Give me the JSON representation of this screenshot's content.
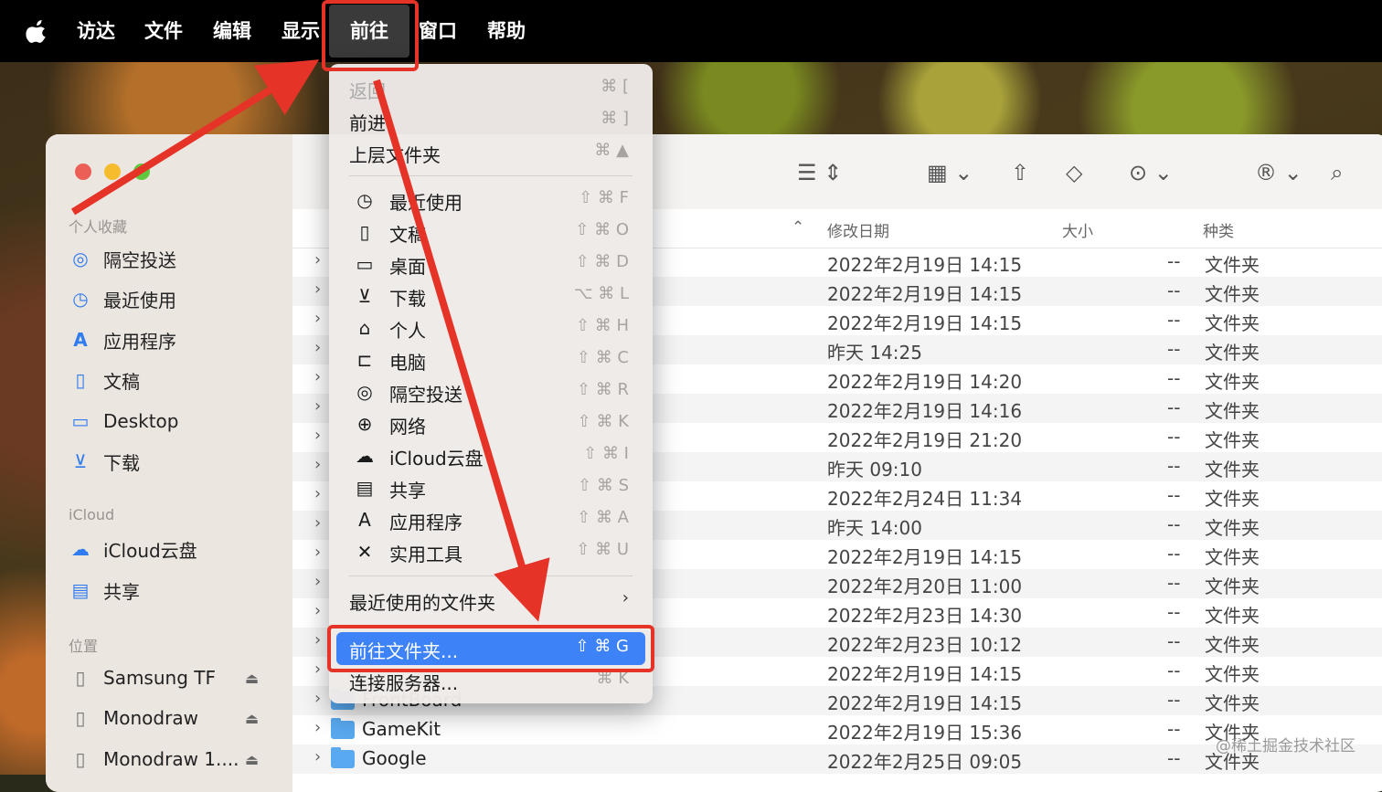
{
  "menubar": {
    "items": [
      "访达",
      "文件",
      "编辑",
      "显示",
      "前往",
      "窗口",
      "帮助"
    ]
  },
  "sidebar": {
    "favorites_title": "个人收藏",
    "favorites": [
      {
        "label": "隔空投送",
        "icon": "airdrop-icon"
      },
      {
        "label": "最近使用",
        "icon": "clock-icon"
      },
      {
        "label": "应用程序",
        "icon": "apps-icon"
      },
      {
        "label": "文稿",
        "icon": "document-icon"
      },
      {
        "label": "Desktop",
        "icon": "desktop-icon"
      },
      {
        "label": "下载",
        "icon": "download-icon"
      }
    ],
    "icloud_title": "iCloud",
    "icloud": [
      {
        "label": "iCloud云盘",
        "icon": "cloud-icon"
      },
      {
        "label": "共享",
        "icon": "shared-folder-icon"
      }
    ],
    "locations_title": "位置",
    "locations": [
      {
        "label": "Samsung TF",
        "icon": "drive-icon"
      },
      {
        "label": "Monodraw",
        "icon": "drive-icon"
      },
      {
        "label": "Monodraw 1....",
        "icon": "drive-icon"
      }
    ]
  },
  "columns": {
    "date": "修改日期",
    "size": "大小",
    "kind": "种类"
  },
  "files": [
    {
      "name": "",
      "date": "2022年2月19日 14:15",
      "size": "--",
      "kind": "文件夹"
    },
    {
      "name": "",
      "date": "2022年2月19日 14:15",
      "size": "--",
      "kind": "文件夹"
    },
    {
      "name": "",
      "date": "2022年2月19日 14:15",
      "size": "--",
      "kind": "文件夹"
    },
    {
      "name": "",
      "date": "昨天 14:25",
      "size": "--",
      "kind": "文件夹"
    },
    {
      "name": "",
      "date": "2022年2月19日 14:20",
      "size": "--",
      "kind": "文件夹"
    },
    {
      "name": "",
      "date": "2022年2月19日 14:16",
      "size": "--",
      "kind": "文件夹"
    },
    {
      "name": "",
      "date": "2022年2月19日 21:20",
      "size": "--",
      "kind": "文件夹"
    },
    {
      "name": "",
      "date": "昨天 09:10",
      "size": "--",
      "kind": "文件夹"
    },
    {
      "name": "",
      "date": "2022年2月24日 11:34",
      "size": "--",
      "kind": "文件夹"
    },
    {
      "name": "",
      "date": "昨天 14:00",
      "size": "--",
      "kind": "文件夹"
    },
    {
      "name": "",
      "date": "2022年2月19日 14:15",
      "size": "--",
      "kind": "文件夹"
    },
    {
      "name": "",
      "date": "2022年2月20日 11:00",
      "size": "--",
      "kind": "文件夹"
    },
    {
      "name": "",
      "date": "2022年2月23日 14:30",
      "size": "--",
      "kind": "文件夹"
    },
    {
      "name": "",
      "date": "2022年2月23日 10:12",
      "size": "--",
      "kind": "文件夹"
    },
    {
      "name": "",
      "date": "2022年2月19日 14:15",
      "size": "--",
      "kind": "文件夹"
    },
    {
      "name": "FrontBoard",
      "date": "2022年2月19日 14:15",
      "size": "--",
      "kind": "文件夹"
    },
    {
      "name": "GameKit",
      "date": "2022年2月19日 15:36",
      "size": "--",
      "kind": "文件夹"
    },
    {
      "name": "Google",
      "date": "2022年2月25日 09:05",
      "size": "--",
      "kind": "文件夹"
    }
  ],
  "go_menu": {
    "top": [
      {
        "label": "返回",
        "shortcut": "⌘ [",
        "disabled": true
      },
      {
        "label": "前进",
        "shortcut": "⌘ ]",
        "disabled": false
      },
      {
        "label": "上层文件夹",
        "shortcut": "⌘ ▲",
        "disabled": false
      }
    ],
    "places": [
      {
        "label": "最近使用",
        "shortcut": "⇧ ⌘ F",
        "icon": "clock-icon",
        "glyph": "◷"
      },
      {
        "label": "文稿",
        "shortcut": "⇧ ⌘ O",
        "icon": "document-icon",
        "glyph": "▯"
      },
      {
        "label": "桌面",
        "shortcut": "⇧ ⌘ D",
        "icon": "desktop-icon",
        "glyph": "▭"
      },
      {
        "label": "下载",
        "shortcut": "⌥ ⌘ L",
        "icon": "download-icon",
        "glyph": "⊻"
      },
      {
        "label": "个人",
        "shortcut": "⇧ ⌘ H",
        "icon": "home-icon",
        "glyph": "⌂"
      },
      {
        "label": "电脑",
        "shortcut": "⇧ ⌘ C",
        "icon": "laptop-icon",
        "glyph": "⊏"
      },
      {
        "label": "隔空投送",
        "shortcut": "⇧ ⌘ R",
        "icon": "airdrop-icon",
        "glyph": "◎"
      },
      {
        "label": "网络",
        "shortcut": "⇧ ⌘ K",
        "icon": "globe-icon",
        "glyph": "⊕"
      },
      {
        "label": "iCloud云盘",
        "shortcut": "⇧ ⌘ I",
        "icon": "cloud-icon",
        "glyph": "☁"
      },
      {
        "label": "共享",
        "shortcut": "⇧ ⌘ S",
        "icon": "shared-folder-icon",
        "glyph": "▤"
      },
      {
        "label": "应用程序",
        "shortcut": "⇧ ⌘ A",
        "icon": "apps-icon",
        "glyph": "A"
      },
      {
        "label": "实用工具",
        "shortcut": "⇧ ⌘ U",
        "icon": "tools-icon",
        "glyph": "✕"
      }
    ],
    "recent_folders": "最近使用的文件夹",
    "goto_folder": {
      "label": "前往文件夹...",
      "shortcut": "⇧ ⌘ G"
    },
    "connect_server": {
      "label": "连接服务器...",
      "shortcut": "⌘ K"
    }
  },
  "watermark": "@稀土掘金技术社区",
  "colors": {
    "highlight": "#3d82f6",
    "annotation": "#e53328",
    "folder": "#59a9f0"
  }
}
